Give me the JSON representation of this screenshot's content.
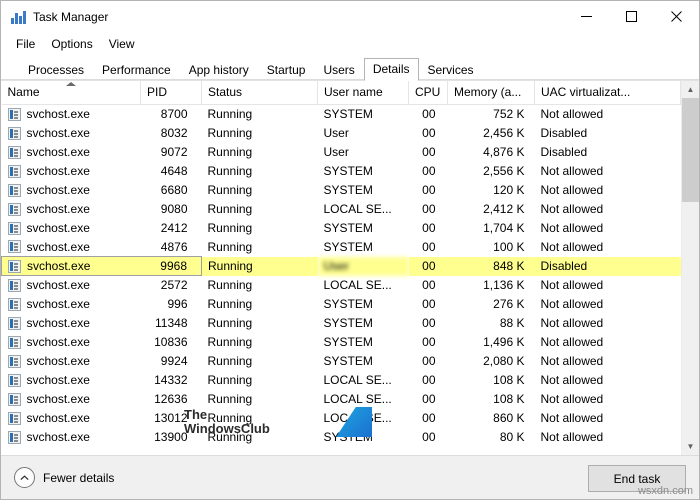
{
  "window": {
    "title": "Task Manager",
    "icon": "task-manager-icon",
    "controls": {
      "minimize": "─",
      "maximize": "□",
      "close": "✕"
    }
  },
  "menu": {
    "items": [
      "File",
      "Options",
      "View"
    ]
  },
  "tabs": {
    "items": [
      "Processes",
      "Performance",
      "App history",
      "Startup",
      "Users",
      "Details",
      "Services"
    ],
    "active": "Details"
  },
  "table": {
    "headers": [
      "Name",
      "PID",
      "Status",
      "User name",
      "CPU",
      "Memory (a...",
      "UAC virtualizat..."
    ],
    "sorted_column": "Name",
    "rows": [
      {
        "name": "svchost.exe",
        "pid": "8700",
        "status": "Running",
        "user": "SYSTEM",
        "cpu": "00",
        "memory": "752 K",
        "uac": "Not allowed",
        "highlight": false,
        "blurred_user": false
      },
      {
        "name": "svchost.exe",
        "pid": "8032",
        "status": "Running",
        "user": "User",
        "cpu": "00",
        "memory": "2,456 K",
        "uac": "Disabled",
        "highlight": false,
        "blurred_user": false
      },
      {
        "name": "svchost.exe",
        "pid": "9072",
        "status": "Running",
        "user": "User",
        "cpu": "00",
        "memory": "4,876 K",
        "uac": "Disabled",
        "highlight": false,
        "blurred_user": false
      },
      {
        "name": "svchost.exe",
        "pid": "4648",
        "status": "Running",
        "user": "SYSTEM",
        "cpu": "00",
        "memory": "2,556 K",
        "uac": "Not allowed",
        "highlight": false,
        "blurred_user": false
      },
      {
        "name": "svchost.exe",
        "pid": "6680",
        "status": "Running",
        "user": "SYSTEM",
        "cpu": "00",
        "memory": "120 K",
        "uac": "Not allowed",
        "highlight": false,
        "blurred_user": false
      },
      {
        "name": "svchost.exe",
        "pid": "9080",
        "status": "Running",
        "user": "LOCAL SE...",
        "cpu": "00",
        "memory": "2,412 K",
        "uac": "Not allowed",
        "highlight": false,
        "blurred_user": false
      },
      {
        "name": "svchost.exe",
        "pid": "2412",
        "status": "Running",
        "user": "SYSTEM",
        "cpu": "00",
        "memory": "1,704 K",
        "uac": "Not allowed",
        "highlight": false,
        "blurred_user": false
      },
      {
        "name": "svchost.exe",
        "pid": "4876",
        "status": "Running",
        "user": "SYSTEM",
        "cpu": "00",
        "memory": "100 K",
        "uac": "Not allowed",
        "highlight": false,
        "blurred_user": false
      },
      {
        "name": "svchost.exe",
        "pid": "9968",
        "status": "Running",
        "user": "User",
        "cpu": "00",
        "memory": "848 K",
        "uac": "Disabled",
        "highlight": true,
        "blurred_user": true
      },
      {
        "name": "svchost.exe",
        "pid": "2572",
        "status": "Running",
        "user": "LOCAL SE...",
        "cpu": "00",
        "memory": "1,136 K",
        "uac": "Not allowed",
        "highlight": false,
        "blurred_user": false
      },
      {
        "name": "svchost.exe",
        "pid": "996",
        "status": "Running",
        "user": "SYSTEM",
        "cpu": "00",
        "memory": "276 K",
        "uac": "Not allowed",
        "highlight": false,
        "blurred_user": false
      },
      {
        "name": "svchost.exe",
        "pid": "11348",
        "status": "Running",
        "user": "SYSTEM",
        "cpu": "00",
        "memory": "88 K",
        "uac": "Not allowed",
        "highlight": false,
        "blurred_user": false
      },
      {
        "name": "svchost.exe",
        "pid": "10836",
        "status": "Running",
        "user": "SYSTEM",
        "cpu": "00",
        "memory": "1,496 K",
        "uac": "Not allowed",
        "highlight": false,
        "blurred_user": false
      },
      {
        "name": "svchost.exe",
        "pid": "9924",
        "status": "Running",
        "user": "SYSTEM",
        "cpu": "00",
        "memory": "2,080 K",
        "uac": "Not allowed",
        "highlight": false,
        "blurred_user": false
      },
      {
        "name": "svchost.exe",
        "pid": "14332",
        "status": "Running",
        "user": "LOCAL SE...",
        "cpu": "00",
        "memory": "108 K",
        "uac": "Not allowed",
        "highlight": false,
        "blurred_user": false
      },
      {
        "name": "svchost.exe",
        "pid": "12636",
        "status": "Running",
        "user": "LOCAL SE...",
        "cpu": "00",
        "memory": "108 K",
        "uac": "Not allowed",
        "highlight": false,
        "blurred_user": false
      },
      {
        "name": "svchost.exe",
        "pid": "13012",
        "status": "Running",
        "user": "LOCAL SE...",
        "cpu": "00",
        "memory": "860 K",
        "uac": "Not allowed",
        "highlight": false,
        "blurred_user": false
      },
      {
        "name": "svchost.exe",
        "pid": "13900",
        "status": "Running",
        "user": "SYSTEM",
        "cpu": "00",
        "memory": "80 K",
        "uac": "Not allowed",
        "highlight": false,
        "blurred_user": false
      }
    ]
  },
  "footer": {
    "fewer_details": "Fewer details",
    "end_task": "End task"
  },
  "watermark": {
    "line1": "The",
    "line2": "WindowsClub",
    "corner": "wsxdn.com"
  }
}
